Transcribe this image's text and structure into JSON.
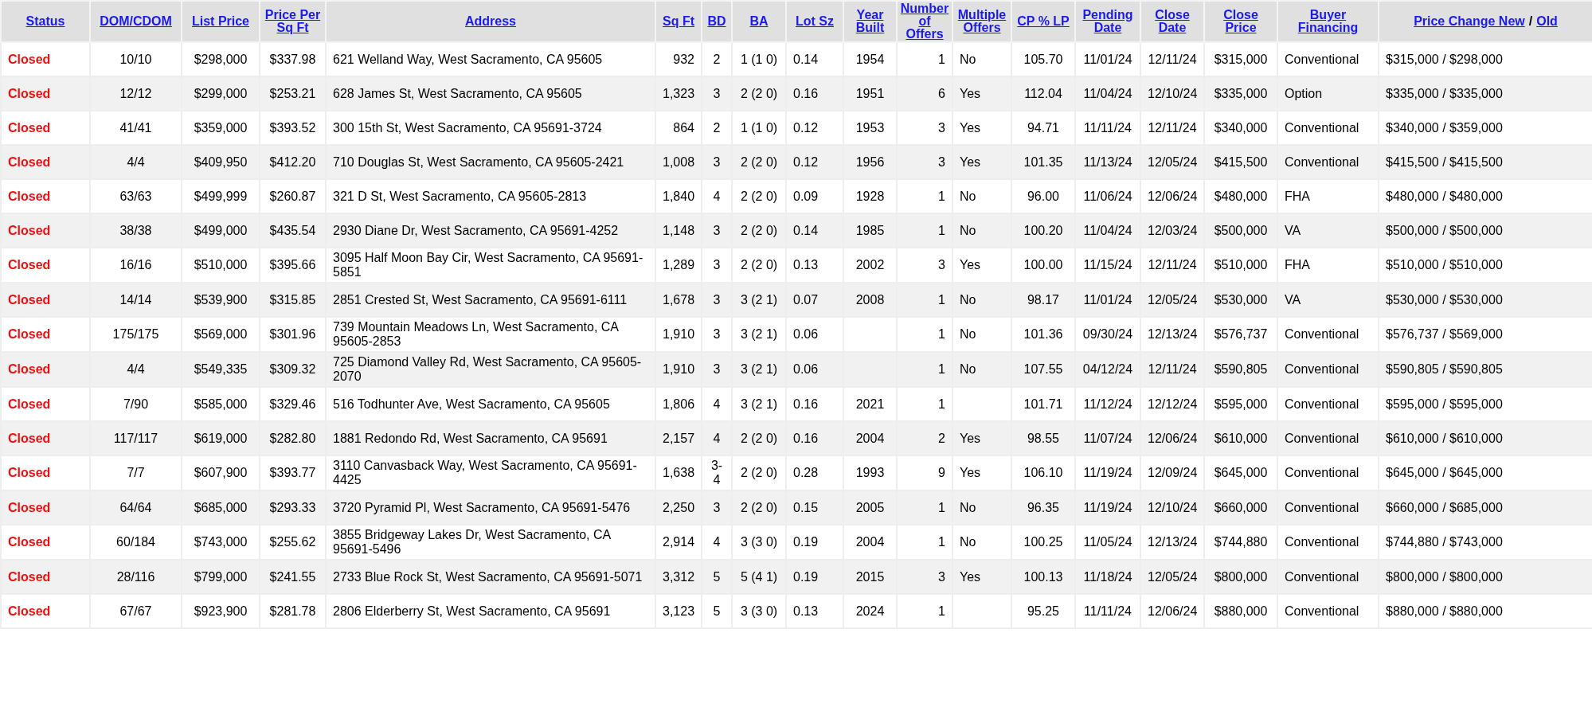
{
  "table": {
    "columns": [
      {
        "label": "Status"
      },
      {
        "label": "DOM/CDOM"
      },
      {
        "label": "List Price"
      },
      {
        "label": "Price Per Sq Ft"
      },
      {
        "label": "Address"
      },
      {
        "label": "Sq Ft"
      },
      {
        "label": "BD"
      },
      {
        "label": "BA"
      },
      {
        "label": "Lot Sz"
      },
      {
        "label": "Year Built"
      },
      {
        "label": "Number of Offers"
      },
      {
        "label": "Multiple Offers"
      },
      {
        "label": "CP % LP"
      },
      {
        "label": "Pending Date"
      },
      {
        "label": "Close Date"
      },
      {
        "label": "Close Price"
      },
      {
        "label": "Buyer Financing"
      },
      {
        "links": [
          "Price Change New",
          "Old"
        ],
        "separator": "/"
      }
    ],
    "rows": [
      [
        "Closed",
        "10/10",
        "$298,000",
        "$337.98",
        "621 Welland Way, West Sacramento, CA 95605",
        "932",
        "2",
        "1 (1 0)",
        "0.14",
        "1954",
        "1",
        "No",
        "105.70",
        "11/01/24",
        "12/11/24",
        "$315,000",
        "Conventional",
        "$315,000 / $298,000"
      ],
      [
        "Closed",
        "12/12",
        "$299,000",
        "$253.21",
        "628 James St, West Sacramento, CA 95605",
        "1,323",
        "3",
        "2 (2 0)",
        "0.16",
        "1951",
        "6",
        "Yes",
        "112.04",
        "11/04/24",
        "12/10/24",
        "$335,000",
        "Option",
        "$335,000 / $335,000"
      ],
      [
        "Closed",
        "41/41",
        "$359,000",
        "$393.52",
        "300 15th St, West Sacramento, CA 95691-3724",
        "864",
        "2",
        "1 (1 0)",
        "0.12",
        "1953",
        "3",
        "Yes",
        "94.71",
        "11/11/24",
        "12/11/24",
        "$340,000",
        "Conventional",
        "$340,000 / $359,000"
      ],
      [
        "Closed",
        "4/4",
        "$409,950",
        "$412.20",
        "710 Douglas St, West Sacramento, CA 95605-2421",
        "1,008",
        "3",
        "2 (2 0)",
        "0.12",
        "1956",
        "3",
        "Yes",
        "101.35",
        "11/13/24",
        "12/05/24",
        "$415,500",
        "Conventional",
        "$415,500 / $415,500"
      ],
      [
        "Closed",
        "63/63",
        "$499,999",
        "$260.87",
        "321 D St, West Sacramento, CA 95605-2813",
        "1,840",
        "4",
        "2 (2 0)",
        "0.09",
        "1928",
        "1",
        "No",
        "96.00",
        "11/06/24",
        "12/06/24",
        "$480,000",
        "FHA",
        "$480,000 / $480,000"
      ],
      [
        "Closed",
        "38/38",
        "$499,000",
        "$435.54",
        "2930 Diane Dr, West Sacramento, CA 95691-4252",
        "1,148",
        "3",
        "2 (2 0)",
        "0.14",
        "1985",
        "1",
        "No",
        "100.20",
        "11/04/24",
        "12/03/24",
        "$500,000",
        "VA",
        "$500,000 / $500,000"
      ],
      [
        "Closed",
        "16/16",
        "$510,000",
        "$395.66",
        "3095 Half Moon Bay Cir, West Sacramento, CA 95691-5851",
        "1,289",
        "3",
        "2 (2 0)",
        "0.13",
        "2002",
        "3",
        "Yes",
        "100.00",
        "11/15/24",
        "12/11/24",
        "$510,000",
        "FHA",
        "$510,000 / $510,000"
      ],
      [
        "Closed",
        "14/14",
        "$539,900",
        "$315.85",
        "2851 Crested St, West Sacramento, CA 95691-6111",
        "1,678",
        "3",
        "3 (2 1)",
        "0.07",
        "2008",
        "1",
        "No",
        "98.17",
        "11/01/24",
        "12/05/24",
        "$530,000",
        "VA",
        "$530,000 / $530,000"
      ],
      [
        "Closed",
        "175/175",
        "$569,000",
        "$301.96",
        "739 Mountain Meadows Ln, West Sacramento, CA 95605-2853",
        "1,910",
        "3",
        "3 (2 1)",
        "0.06",
        "",
        "1",
        "No",
        "101.36",
        "09/30/24",
        "12/13/24",
        "$576,737",
        "Conventional",
        "$576,737 / $569,000"
      ],
      [
        "Closed",
        "4/4",
        "$549,335",
        "$309.32",
        "725 Diamond Valley Rd, West Sacramento, CA 95605-2070",
        "1,910",
        "3",
        "3 (2 1)",
        "0.06",
        "",
        "1",
        "No",
        "107.55",
        "04/12/24",
        "12/11/24",
        "$590,805",
        "Conventional",
        "$590,805 / $590,805"
      ],
      [
        "Closed",
        "7/90",
        "$585,000",
        "$329.46",
        "516 Todhunter Ave, West Sacramento, CA 95605",
        "1,806",
        "4",
        "3 (2 1)",
        "0.16",
        "2021",
        "1",
        "",
        "101.71",
        "11/12/24",
        "12/12/24",
        "$595,000",
        "Conventional",
        "$595,000 / $595,000"
      ],
      [
        "Closed",
        "117/117",
        "$619,000",
        "$282.80",
        "1881 Redondo Rd, West Sacramento, CA 95691",
        "2,157",
        "4",
        "2 (2 0)",
        "0.16",
        "2004",
        "2",
        "Yes",
        "98.55",
        "11/07/24",
        "12/06/24",
        "$610,000",
        "Conventional",
        "$610,000 / $610,000"
      ],
      [
        "Closed",
        "7/7",
        "$607,900",
        "$393.77",
        "3110 Canvasback Way, West Sacramento, CA 95691-4425",
        "1,638",
        "3-4",
        "2 (2 0)",
        "0.28",
        "1993",
        "9",
        "Yes",
        "106.10",
        "11/19/24",
        "12/09/24",
        "$645,000",
        "Conventional",
        "$645,000 / $645,000"
      ],
      [
        "Closed",
        "64/64",
        "$685,000",
        "$293.33",
        "3720 Pyramid Pl, West Sacramento, CA 95691-5476",
        "2,250",
        "3",
        "2 (2 0)",
        "0.15",
        "2005",
        "1",
        "No",
        "96.35",
        "11/19/24",
        "12/10/24",
        "$660,000",
        "Conventional",
        "$660,000 / $685,000"
      ],
      [
        "Closed",
        "60/184",
        "$743,000",
        "$255.62",
        "3855 Bridgeway Lakes Dr, West Sacramento, CA 95691-5496",
        "2,914",
        "4",
        "3 (3 0)",
        "0.19",
        "2004",
        "1",
        "No",
        "100.25",
        "11/05/24",
        "12/13/24",
        "$744,880",
        "Conventional",
        "$744,880 / $743,000"
      ],
      [
        "Closed",
        "28/116",
        "$799,000",
        "$241.55",
        "2733 Blue Rock St, West Sacramento, CA 95691-5071",
        "3,312",
        "5",
        "5 (4 1)",
        "0.19",
        "2015",
        "3",
        "Yes",
        "100.13",
        "11/18/24",
        "12/05/24",
        "$800,000",
        "Conventional",
        "$800,000 / $800,000"
      ],
      [
        "Closed",
        "67/67",
        "$923,900",
        "$281.78",
        "2806 Elderberry St, West Sacramento, CA 95691",
        "3,123",
        "5",
        "3 (3 0)",
        "0.13",
        "2024",
        "1",
        "",
        "95.25",
        "11/11/24",
        "12/06/24",
        "$880,000",
        "Conventional",
        "$880,000 / $880,000"
      ]
    ]
  }
}
